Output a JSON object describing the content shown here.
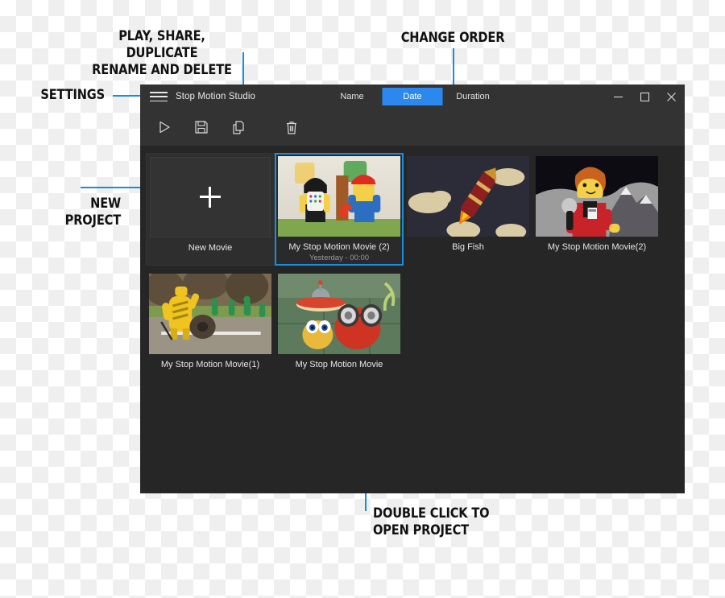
{
  "annotations": [
    {
      "id": "settings",
      "text": "SETTINGS"
    },
    {
      "id": "play_share",
      "text": "PLAY, SHARE, DUPLICATE\nRENAME AND DELETE"
    },
    {
      "id": "change_order",
      "text": "CHANGE ORDER"
    },
    {
      "id": "new_project",
      "text": "NEW PROJECT"
    },
    {
      "id": "double_click",
      "text": "DOUBLE CLICK TO\nOPEN PROJECT"
    }
  ],
  "colors": {
    "accent_blue": "#1a8cdd",
    "tab_active": "#2b88ef",
    "titlebar": "#333333",
    "content_bg": "#262626",
    "annotation_text": "#111111"
  },
  "window": {
    "title": "Stop Motion Studio",
    "menu_icon": "hamburger-icon",
    "sort_tabs": [
      {
        "label": "Name",
        "active": false
      },
      {
        "label": "Date",
        "active": true
      },
      {
        "label": "Duration",
        "active": false
      }
    ],
    "window_controls": [
      {
        "name": "minimize-button",
        "icon": "minimize-icon"
      },
      {
        "name": "maximize-button",
        "icon": "maximize-icon"
      },
      {
        "name": "close-button",
        "icon": "close-icon"
      }
    ],
    "toolbar": [
      {
        "name": "play-button",
        "icon": "play-icon"
      },
      {
        "name": "save-button",
        "icon": "save-icon"
      },
      {
        "name": "duplicate-button",
        "icon": "copy-icon"
      },
      {
        "name": "delete-button",
        "icon": "trash-icon"
      }
    ]
  },
  "projects": [
    {
      "kind": "new",
      "label": "New Movie",
      "subtitle": "",
      "selected": false,
      "thumb": "plus-placeholder"
    },
    {
      "kind": "project",
      "label": "My Stop Motion Movie (2)",
      "subtitle": "Yesterday - 00:00",
      "selected": true,
      "thumb": "lego-two-minifigs"
    },
    {
      "kind": "project",
      "label": "Big Fish",
      "subtitle": "",
      "selected": false,
      "thumb": "paper-rocket-clouds"
    },
    {
      "kind": "project",
      "label": "My Stop Motion Movie(2)",
      "subtitle": "",
      "selected": false,
      "thumb": "lego-reporter-moon"
    },
    {
      "kind": "project",
      "label": "My Stop Motion Movie(1)",
      "subtitle": "",
      "selected": false,
      "thumb": "clay-yellow-character"
    },
    {
      "kind": "project",
      "label": "My Stop Motion Movie",
      "subtitle": "",
      "selected": false,
      "thumb": "clay-googly-ufo"
    }
  ]
}
